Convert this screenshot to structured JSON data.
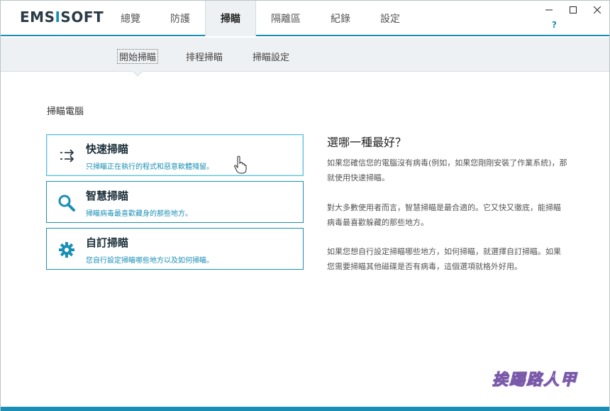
{
  "app": {
    "logo_prefix": "EMS",
    "logo_accent": "I",
    "logo_suffix": "SOFT"
  },
  "nav": {
    "items": [
      {
        "label": "總覽"
      },
      {
        "label": "防護"
      },
      {
        "label": "掃瞄"
      },
      {
        "label": "隔離區"
      },
      {
        "label": "紀錄"
      },
      {
        "label": "設定"
      }
    ],
    "active_index": 2
  },
  "window_controls": {
    "minimize": "—",
    "maximize": "☐",
    "close": "✕"
  },
  "help": {
    "label": "?"
  },
  "subnav": {
    "items": [
      {
        "label": "開始掃瞄"
      },
      {
        "label": "排程掃瞄"
      },
      {
        "label": "掃瞄設定"
      }
    ]
  },
  "section": {
    "title": "掃瞄電腦"
  },
  "scans": [
    {
      "title": "快速掃瞄",
      "desc": "只掃瞄正在執行的程式和惡意軟體殘留。",
      "icon": "quick-scan-icon"
    },
    {
      "title": "智慧掃瞄",
      "desc": "掃瞄病毒最喜歡藏身的那些地方。",
      "icon": "magnifier-icon"
    },
    {
      "title": "自訂掃瞄",
      "desc": "您自行設定掃瞄哪些地方以及如何掃瞄。",
      "icon": "gear-icon"
    }
  ],
  "info": {
    "title": "選哪一種最好？",
    "p1": "如果您確信您的電腦沒有病毒(例如，如果您剛剛安裝了作業系統)，那就使用快速掃瞄。",
    "p2": "對大多數使用者而言，智慧掃瞄是最合適的。它又快又徹底，能掃瞄病毒最喜歡躲藏的那些地方。",
    "p3": "如果您想自行設定掃瞄哪些地方，如何掃瞄，就選擇自訂掃瞄。如果您需要掃瞄其他磁碟是否有病毒，這個選項就格外好用。"
  },
  "watermark": {
    "text": "挨踢路人甲"
  },
  "colors": {
    "accent": "#1a8fb5",
    "subnav_bg": "#eef1f3"
  }
}
